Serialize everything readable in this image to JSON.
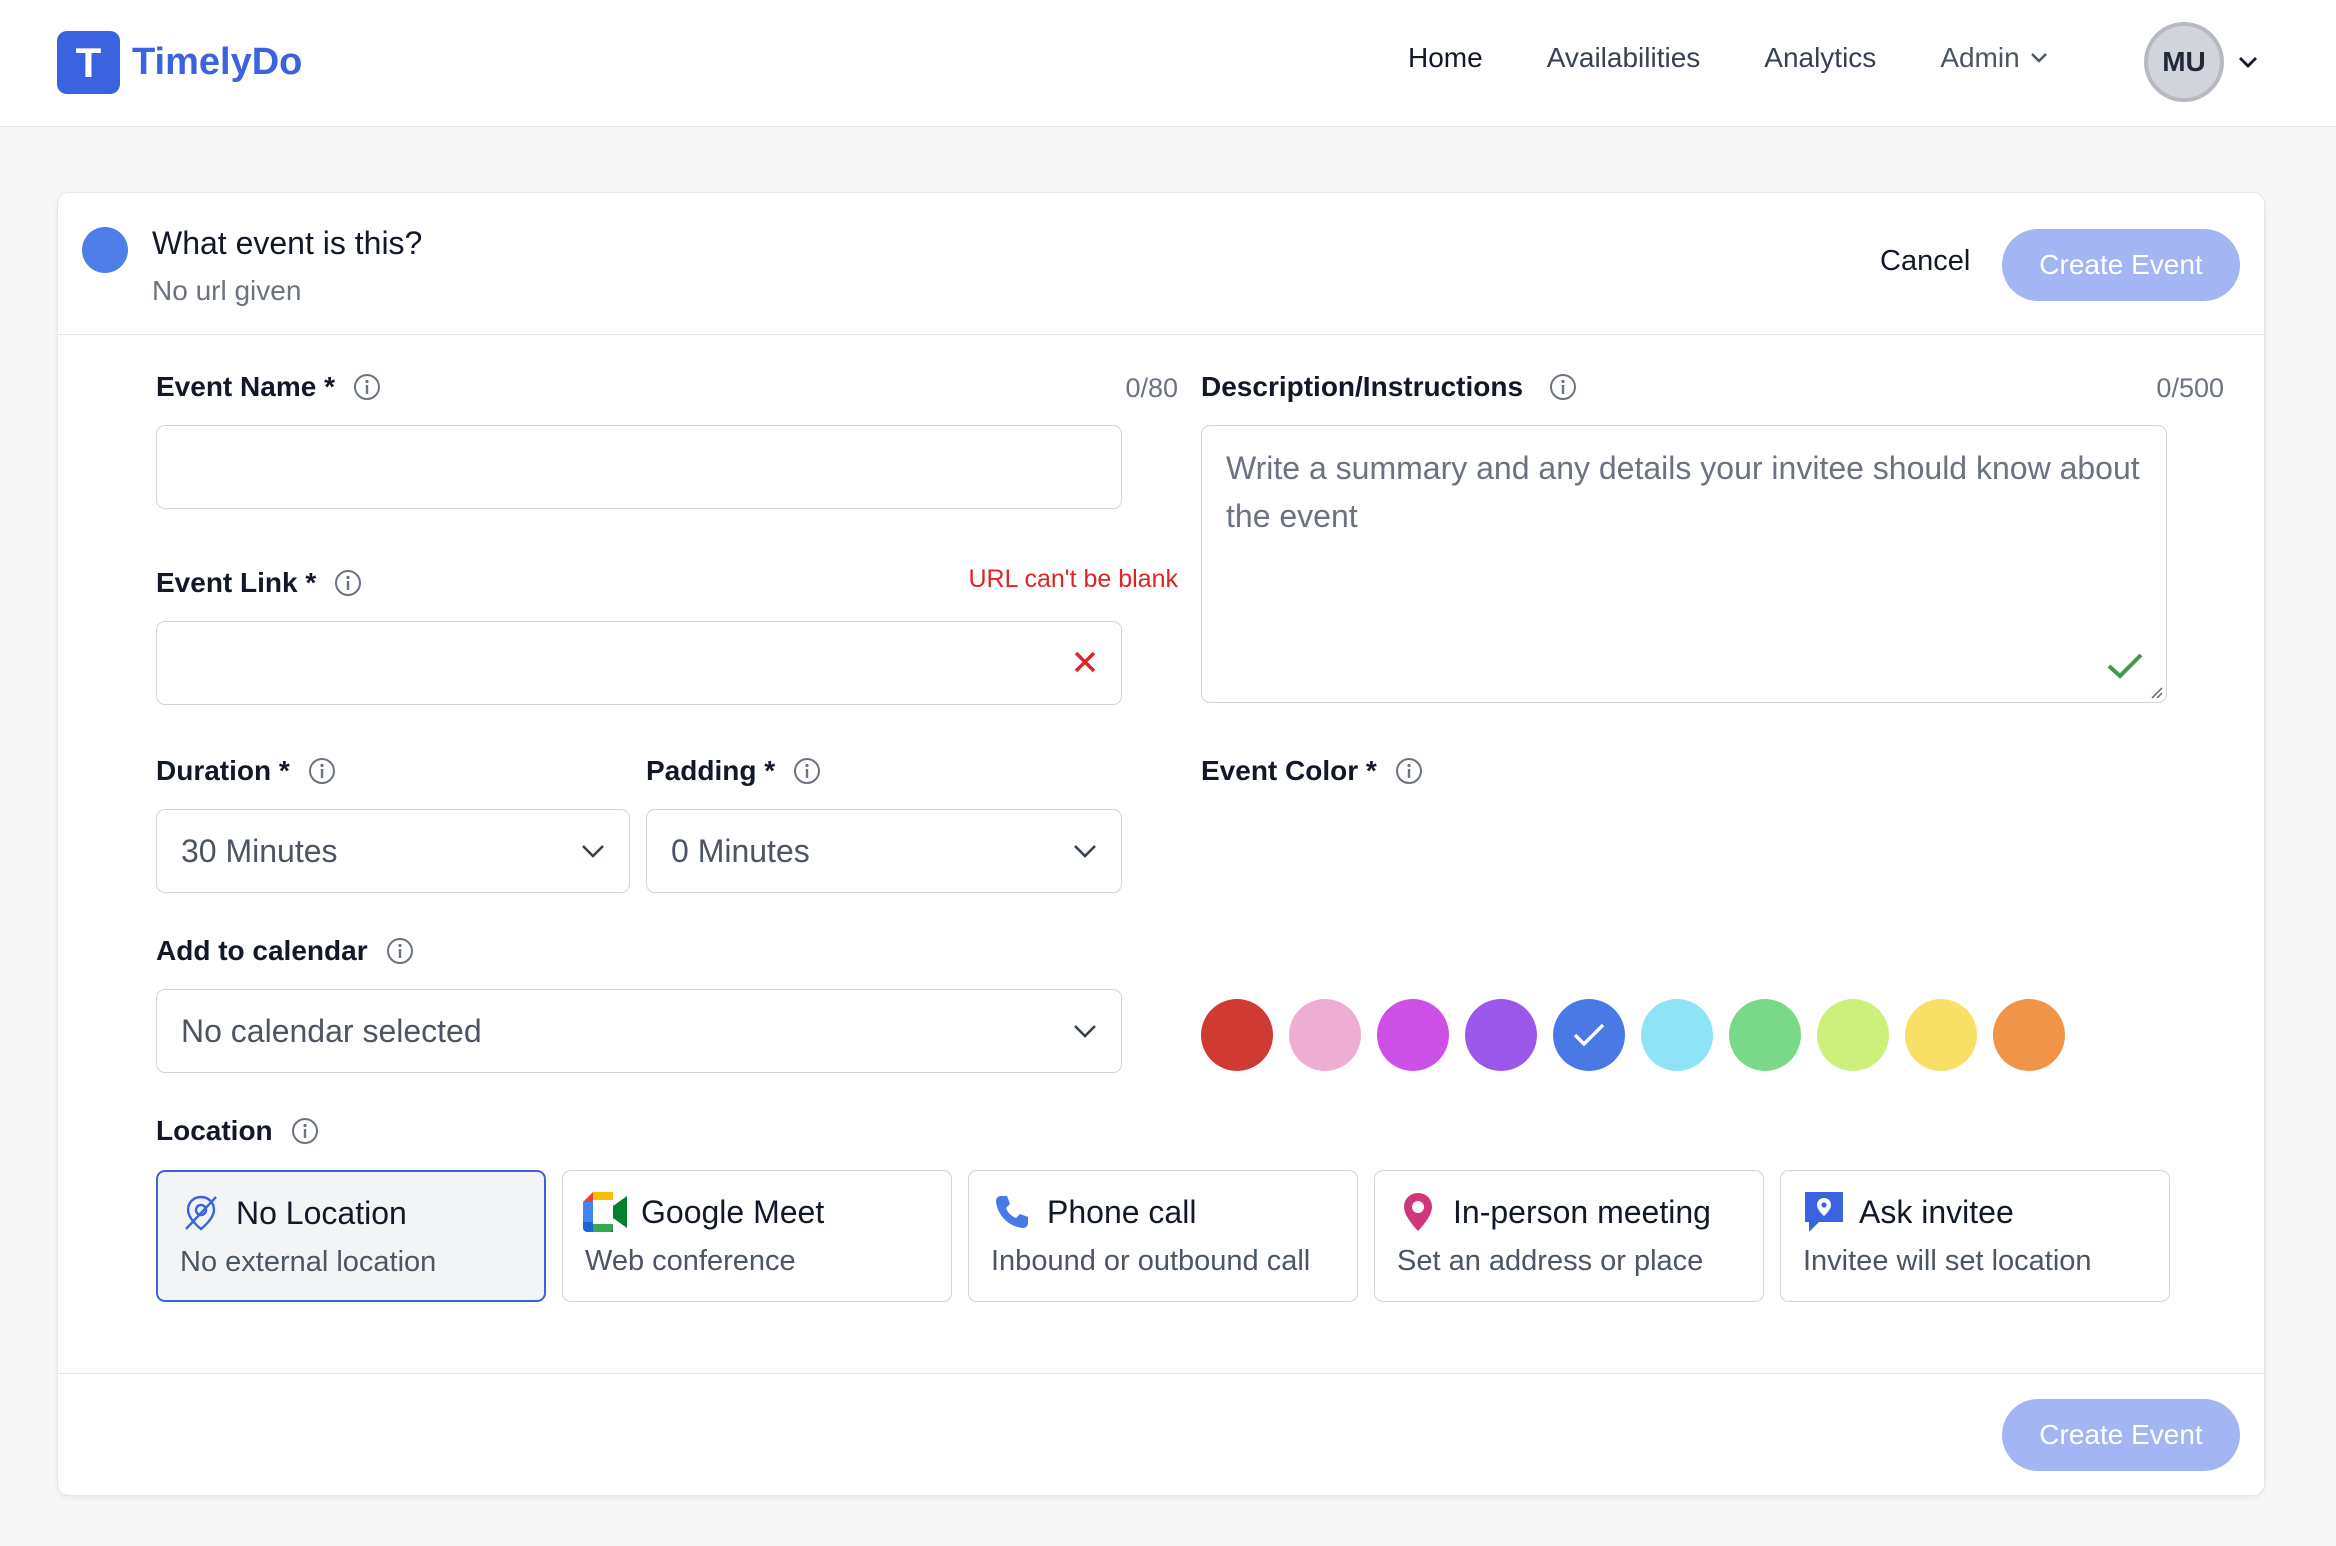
{
  "brand": {
    "logo_letter": "T",
    "name": "TimelyDo",
    "color": "#3b63e0"
  },
  "nav": {
    "links": [
      "Home",
      "Availabilities",
      "Analytics"
    ],
    "admin": "Admin",
    "avatar_initials": "MU"
  },
  "header": {
    "event_title": "What event is this?",
    "event_url": "No url given",
    "cancel": "Cancel",
    "create": "Create Event",
    "dot_color": "#4f7ee8"
  },
  "form": {
    "event_name": {
      "label": "Event Name *",
      "counter": "0/80",
      "value": ""
    },
    "event_link": {
      "label": "Event Link *",
      "error": "URL can't be blank",
      "value": ""
    },
    "duration": {
      "label": "Duration *",
      "value": "30 Minutes"
    },
    "padding": {
      "label": "Padding *",
      "value": "0 Minutes"
    },
    "calendar": {
      "label": "Add to calendar",
      "value": "No calendar selected"
    },
    "description": {
      "label": "Description/Instructions",
      "counter": "0/500",
      "placeholder": "Write a summary and any details your invitee should know about the event"
    },
    "event_color": {
      "label": "Event Color *",
      "colors": [
        "#cf3a32",
        "#eeaed3",
        "#cc4fe6",
        "#9b57ea",
        "#4a79e6",
        "#8ee3f4",
        "#7ad889",
        "#cdf07c",
        "#f8df66",
        "#ef9449"
      ],
      "selected_index": 4
    },
    "location": {
      "label": "Location",
      "options": [
        {
          "title": "No Location",
          "subtitle": "No external location",
          "icon": "no-location-icon"
        },
        {
          "title": "Google Meet",
          "subtitle": "Web conference",
          "icon": "google-meet-icon"
        },
        {
          "title": "Phone call",
          "subtitle": "Inbound or outbound call",
          "icon": "phone-icon"
        },
        {
          "title": "In-person meeting",
          "subtitle": "Set an address or place",
          "icon": "map-pin-icon"
        },
        {
          "title": "Ask invitee",
          "subtitle": "Invitee will set location",
          "icon": "chat-pin-icon"
        }
      ],
      "selected_index": 0
    }
  },
  "footer": {
    "create": "Create Event"
  }
}
